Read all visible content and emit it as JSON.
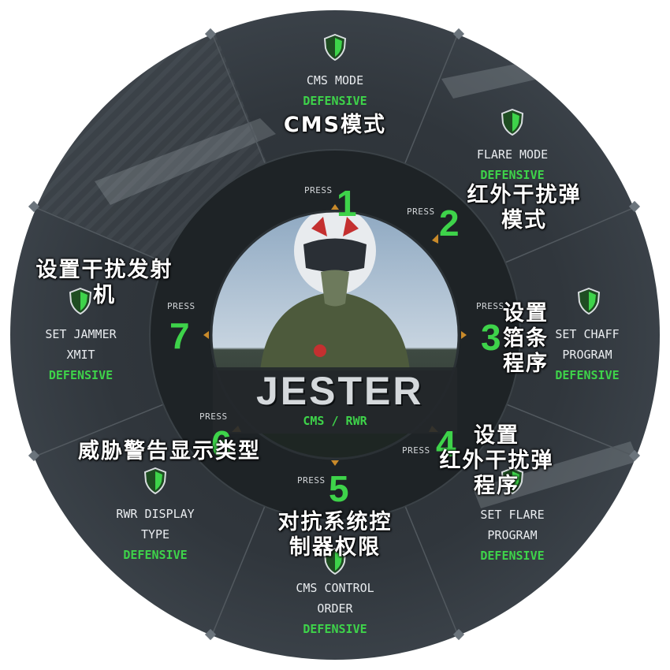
{
  "title": "JESTER",
  "subtitle": "CMS / RWR",
  "press_label": "PRESS",
  "colors": {
    "accent": "#3ed34a",
    "ring": "#2f353b",
    "inner": "#1f2427"
  },
  "items": [
    {
      "number": "1",
      "lines": [
        "CMS MODE"
      ],
      "value": "DEFENSIVE",
      "overlay": [
        "CMS模式"
      ],
      "icon": "shield-icon"
    },
    {
      "number": "2",
      "lines": [
        "FLARE MODE"
      ],
      "value": "DEFENSIVE",
      "overlay": [
        "红外干扰弹",
        "模式"
      ],
      "icon": "shield-icon"
    },
    {
      "number": "3",
      "lines": [
        "SET CHAFF",
        "PROGRAM"
      ],
      "value": "DEFENSIVE",
      "overlay": [
        "设置",
        "箔条",
        "程序"
      ],
      "icon": "shield-icon"
    },
    {
      "number": "4",
      "lines": [
        "SET FLARE",
        "PROGRAM"
      ],
      "value": "DEFENSIVE",
      "overlay": [
        "设置",
        "红外干扰弹",
        "程序"
      ],
      "icon": "shield-icon"
    },
    {
      "number": "5",
      "lines": [
        "CMS CONTROL",
        "ORDER"
      ],
      "value": "DEFENSIVE",
      "overlay": [
        "对抗系统控",
        "制器权限"
      ],
      "icon": "shield-icon"
    },
    {
      "number": "6",
      "lines": [
        "RWR DISPLAY",
        "TYPE"
      ],
      "value": "DEFENSIVE",
      "overlay": [
        "威胁警告显示类型"
      ],
      "icon": "shield-icon"
    },
    {
      "number": "7",
      "lines": [
        "SET JAMMER",
        "XMIT"
      ],
      "value": "DEFENSIVE",
      "overlay": [
        "设置干扰发射",
        "机"
      ],
      "icon": "shield-icon"
    }
  ]
}
